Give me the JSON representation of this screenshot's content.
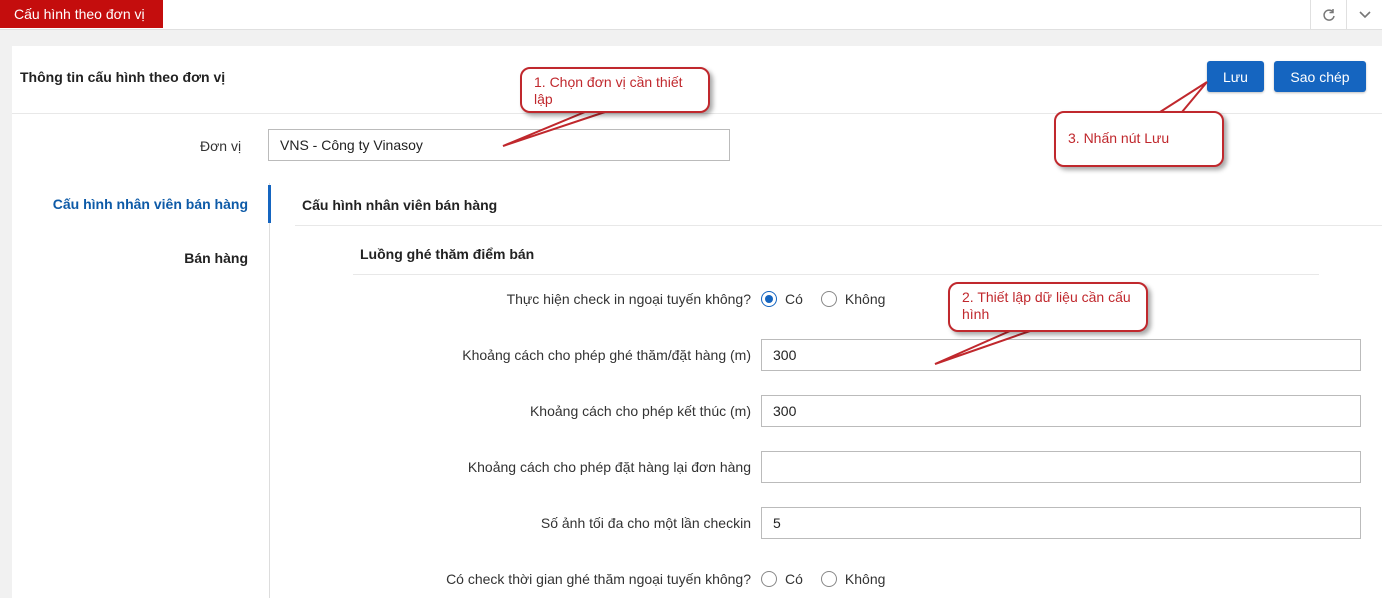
{
  "tabbar": {
    "active_tab": "Cấu hình theo đơn vị",
    "refresh_icon": "refresh-icon",
    "chevron_icon": "chevron-down-icon"
  },
  "header": {
    "title": "Thông tin cấu hình theo đơn vị",
    "save_label": "Lưu",
    "copy_label": "Sao chép"
  },
  "unit": {
    "label": "Đơn vị",
    "value": "VNS - Công ty Vinasoy"
  },
  "sidebar": {
    "items": [
      {
        "label": "Cấu hình nhân viên bán hàng",
        "active": true
      },
      {
        "label": "Bán hàng",
        "active": false
      }
    ]
  },
  "content": {
    "section_title": "Cấu hình nhân viên bán hàng",
    "group_title": "Luồng ghé thăm điểm bán",
    "fields": {
      "offline_checkin": {
        "label": "Thực hiện check in ngoại tuyến không?",
        "yes": "Có",
        "no": "Không",
        "selected": "Có"
      },
      "visit_distance": {
        "label": "Khoảng cách cho phép ghé thăm/đặt hàng (m)",
        "value": "300"
      },
      "end_distance": {
        "label": "Khoảng cách cho phép kết thúc (m)",
        "value": "300"
      },
      "reorder_distance": {
        "label": "Khoảng cách cho phép đặt hàng lại đơn hàng",
        "value": ""
      },
      "max_photos": {
        "label": "Số ảnh tối đa cho một lần checkin",
        "value": "5"
      },
      "offline_visit_time": {
        "label": "Có check thời gian ghé thăm ngoại tuyến không?",
        "yes": "Có",
        "no": "Không",
        "selected": ""
      }
    }
  },
  "callouts": {
    "step1": "1. Chọn đơn vị cần thiết lập",
    "step2": "2. Thiết lập dữ liệu cần cấu hình",
    "step3": "3. Nhấn nút Lưu"
  },
  "colors": {
    "tab_red": "#c40d0d",
    "primary_blue": "#1565c0",
    "callout_red": "#c0282d"
  }
}
